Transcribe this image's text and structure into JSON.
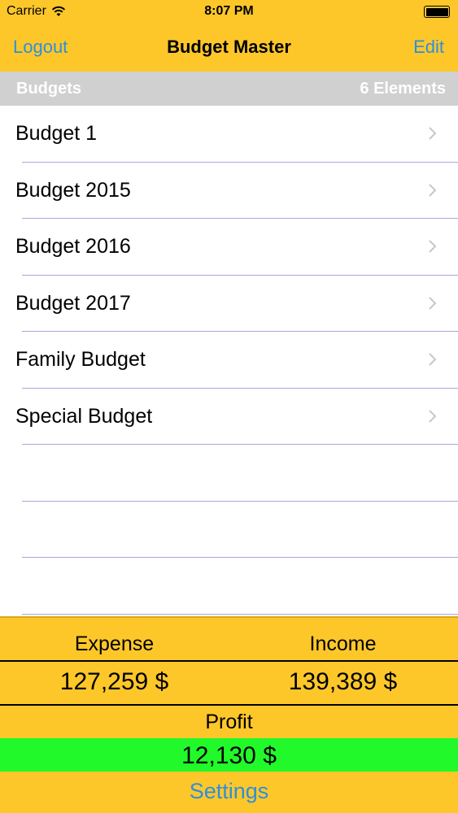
{
  "status_bar": {
    "carrier": "Carrier",
    "time": "8:07 PM"
  },
  "nav": {
    "left": "Logout",
    "title": "Budget Master",
    "right": "Edit"
  },
  "section": {
    "title": "Budgets",
    "count": "6 Elements"
  },
  "budgets": [
    "Budget 1",
    "Budget 2015",
    "Budget 2016",
    "Budget 2017",
    "Family Budget",
    "Special Budget"
  ],
  "summary": {
    "expense_label": "Expense",
    "income_label": "Income",
    "expense_value": "127,259 $",
    "income_value": "139,389 $",
    "profit_label": "Profit",
    "profit_value": "12,130 $",
    "settings_label": "Settings"
  },
  "colors": {
    "accent_yellow": "#fdc72a",
    "link_blue": "#2e8fdc",
    "profit_green": "#21f92a",
    "header_gray": "#d0d0d0"
  },
  "icons": {
    "wifi": "wifi-icon",
    "battery": "battery-icon",
    "chevron": "chevron-right-icon"
  }
}
